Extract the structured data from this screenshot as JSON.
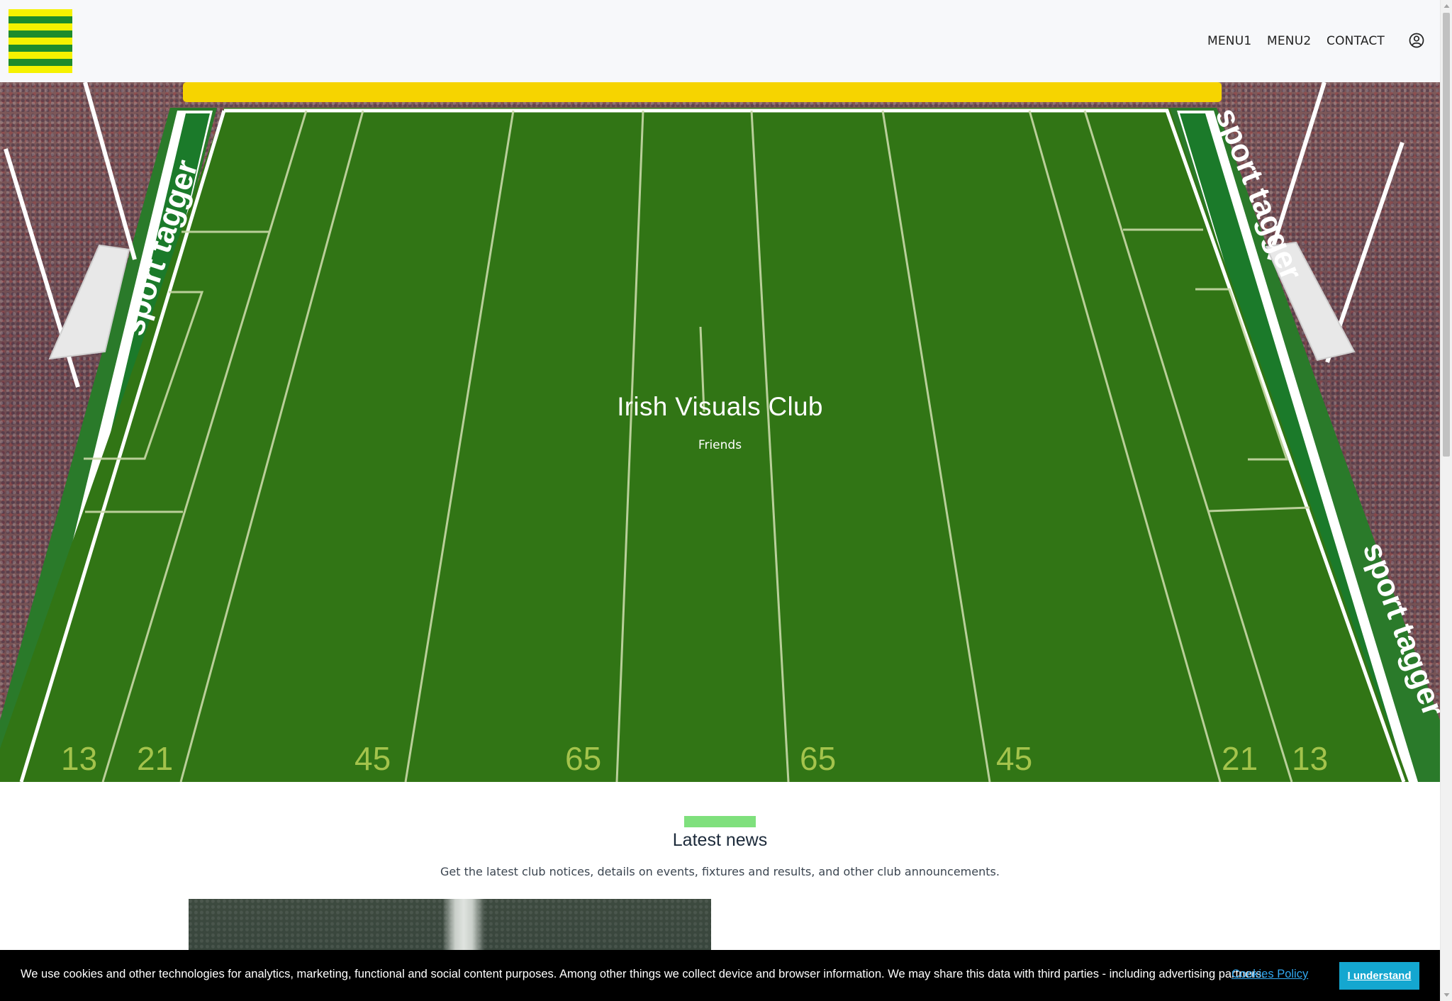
{
  "brand": {
    "logo_stripe_colors": [
      "#f6f200",
      "#1e8c2c"
    ]
  },
  "nav": {
    "items": [
      "MENU1",
      "MENU2",
      "CONTACT"
    ],
    "account_icon": "user-circle-icon"
  },
  "hero": {
    "title": "Irish Visuals Club",
    "subtitle": "Friends",
    "pitch_markings": [
      "13",
      "21",
      "45",
      "65",
      "65",
      "45",
      "21",
      "13"
    ],
    "ad_board_text": "sport tagger",
    "pitch_color": "#317515",
    "crossbar_color": "#f6d400"
  },
  "latest_news": {
    "title": "Latest news",
    "description": "Get the latest club notices, details on events, fixtures and results, and other club announcements.",
    "accent_color": "#7fe07d"
  },
  "cookie_banner": {
    "text": "We use cookies and other technologies for analytics, marketing, functional and social content purposes. Among other things we collect device and browser information. We may share this data with third parties - including advertising partners.",
    "policy_link": "Cookies Policy",
    "accept_button": "I understand"
  }
}
